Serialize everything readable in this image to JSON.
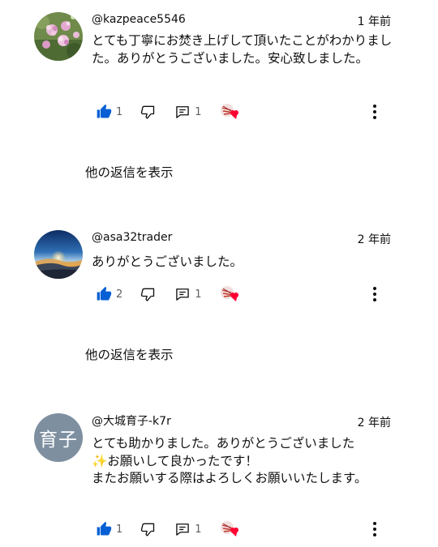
{
  "comments": [
    {
      "handle": "@kazpeace5546",
      "time": "1 年前",
      "text": "とても丁寧にお焚き上げして頂いたことがわかりました。ありがとうございました。安心致しました。",
      "likes": "1",
      "replies": "1",
      "show_replies": "他の返信を表示",
      "avatar": "hydrangea-photo"
    },
    {
      "handle": "@asa32trader",
      "time": "2 年前",
      "text": "ありがとうございました。",
      "likes": "2",
      "replies": "1",
      "show_replies": "他の返信を表示",
      "avatar": "sunrise-photo"
    },
    {
      "handle": "@大城育子-k7r",
      "time": "2 年前",
      "text": "とても助かりました。ありがとうございました\n✨お願いして良かったです！\nまたお願いする際はよろしくお願いいたします。",
      "likes": "1",
      "replies": "1",
      "avatar_initials": "育子",
      "avatar_color": "#7e8fa0"
    }
  ],
  "colors": {
    "like_active": "#065fd4",
    "heart": "#ff0033",
    "text": "#0f0f0f",
    "muted": "#606060"
  },
  "icons": [
    "thumbs-up-icon",
    "thumbs-down-icon",
    "reply-icon",
    "creator-heart-icon",
    "more-vert-icon"
  ]
}
